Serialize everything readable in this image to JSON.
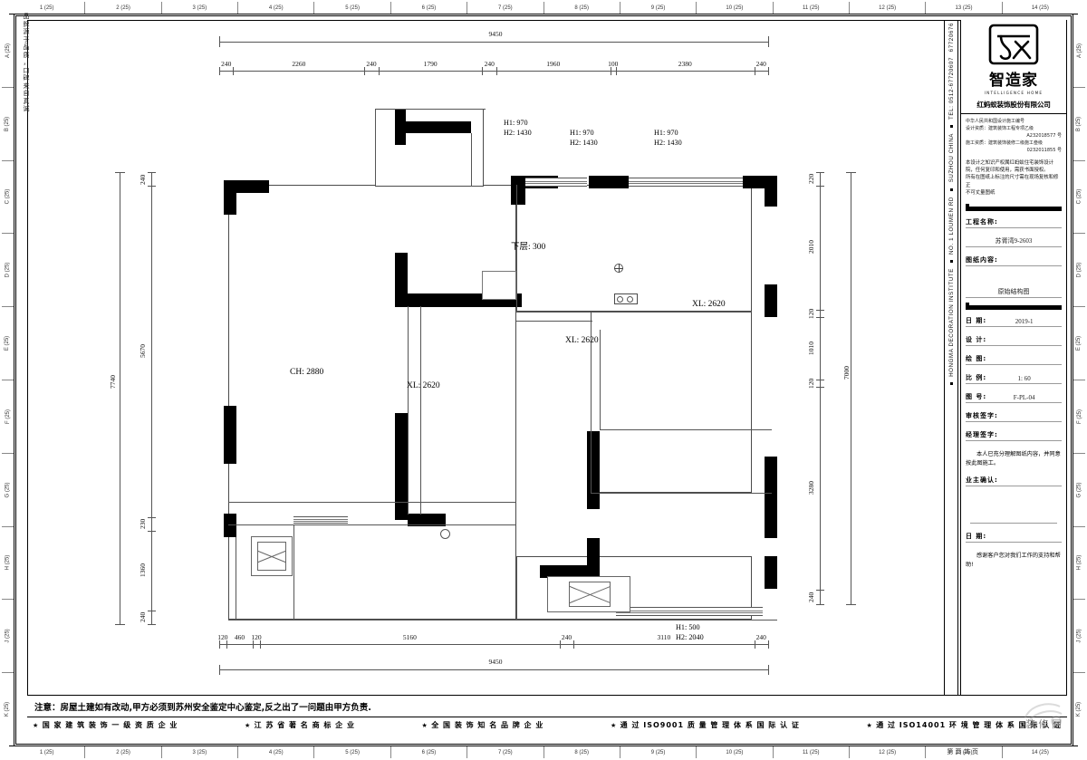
{
  "sheet": {
    "slogan_vertical": "品牌源于品质，口碑来自真诚",
    "sheet_number_label": "第 页 共 页"
  },
  "rulers": {
    "h_ticks": [
      "1 (25)",
      "2 (25)",
      "3 (25)",
      "4 (25)",
      "5 (25)",
      "6 (25)",
      "7 (25)",
      "8 (25)",
      "9 (25)",
      "10 (25)",
      "11 (25)",
      "12 (25)",
      "13 (25)",
      "14 (25)"
    ],
    "v_ticks": [
      "A\n(25)",
      "B\n(25)",
      "C\n(25)",
      "D\n(25)",
      "E\n(25)",
      "F\n(25)",
      "G\n(25)",
      "H\n(25)",
      "J\n(25)",
      "K\n(25)"
    ],
    "v_ticks_flat": [
      "A (25)",
      "B (25)",
      "C (25)",
      "D (25)",
      "E (25)",
      "F (25)",
      "G (25)",
      "H (25)",
      "J (25)",
      "K (25)"
    ]
  },
  "vertical_strip": {
    "line1": "HONGMA DECORATION INSTITUTE",
    "line2": "SUZHOU CHINA",
    "line3": "TEL: 0512-67720607",
    "line4": "67720676",
    "line5": "NO. 1 LOUMEN RD"
  },
  "title_block": {
    "brand_cn": "智造家",
    "brand_en": "INTELLIGENCE HOME",
    "company": "红蚂蚁装饰股份有限公司",
    "cert": {
      "l1": "中华人民共和国设计施工编号",
      "l2": "设计资质：建筑装饰工程专项乙级",
      "l3": "A232018577 号",
      "l4": "施工资质：建筑装饰装修二级施工叁级",
      "l5": "0232011855 号"
    },
    "legal": "本设计之知识产权属红蚂蚁住宅装饰设计院，任何复印和使用，需获书面授权。\n所有在图纸上标注的尺寸需在现场复核和修正\n不可丈量图纸",
    "fields": [
      {
        "key": "工程名称:",
        "value": ""
      },
      {
        "key": "",
        "value": "苏胥湾9-2603"
      },
      {
        "key": "图纸内容:",
        "value": ""
      },
      {
        "key": "",
        "value": "原始结构图"
      }
    ],
    "project_name_label": "工程名称:",
    "project_name_value": "苏胥湾9-2603",
    "drawing_content_label": "图纸内容:",
    "drawing_content_value": "原始结构图",
    "meta": [
      {
        "key": "日  期:",
        "value": "2019-1"
      },
      {
        "key": "设  计:",
        "value": ""
      },
      {
        "key": "绘  图:",
        "value": ""
      },
      {
        "key": "比  例:",
        "value": "1: 60"
      },
      {
        "key": "图  号:",
        "value": "F-PL-04"
      },
      {
        "key": "审核签字:",
        "value": ""
      },
      {
        "key": "经理签字:",
        "value": ""
      }
    ],
    "owner_confirm_text": "本人已充分理解图纸内容，并同意按此图施工。",
    "owner_confirm_label": "业主确认:",
    "date_label": "日    期:",
    "thanks_text": "感谢客户您对我们工作的支持和帮助!"
  },
  "notes": {
    "warning": "注意：房屋土建如有改动,甲方必须到苏州安全鉴定中心鉴定,反之出了一问题由甲方负责.",
    "certs": [
      "国 家 建 筑 装 饰 一 级 资 质 企 业",
      "江 苏 省 著 名 商 标 企 业",
      "全 国 装 饰 知 名 品 牌 企 业",
      "通 过 ISO9001 质 量 管 理 体 系 国 际 认 证",
      "通 过 ISO14001 环 境 管 理 体 系 国 际 认 证"
    ],
    "watermark": "装 修 网"
  },
  "chart_data": {
    "type": "table",
    "title": "原始结构图 — 苏胥湾9-2603",
    "scale": "1: 60",
    "dimensions_top_total": "9450",
    "dimensions_top_chain": [
      "240",
      "2260",
      "240",
      "1790",
      "240",
      "1960",
      "100",
      "2380",
      "240"
    ],
    "dimensions_bottom_total": "9450",
    "dimensions_bottom_chain": [
      "120",
      "460",
      "120",
      "5160",
      "240",
      "3110",
      "240"
    ],
    "dimensions_left_total": "7740",
    "dimensions_left_chain": [
      "240",
      "5670",
      "230",
      "1360",
      "240"
    ],
    "dimensions_right_total": "7000",
    "dimensions_right_chain": [
      "220",
      "2010",
      "120",
      "1010",
      "120",
      "3280",
      "240"
    ]
  },
  "plan": {
    "labels": {
      "ceiling_height": "CH: 2880",
      "beam_1": "XL: 2620",
      "beam_2": "XL: 2620",
      "beam_3": "XL: 2620",
      "lower_slab": "下层: 300"
    },
    "window_notes": [
      {
        "h1": "H1: 970",
        "h2": "H2: 1430"
      },
      {
        "h1": "H1: 970",
        "h2": "H2: 1430"
      },
      {
        "h1": "H1: 970",
        "h2": "H2: 1430"
      },
      {
        "h1": "H1: 500",
        "h2": "H2: 2040"
      }
    ]
  },
  "dim_top": {
    "total": "9450",
    "chain": [
      "240",
      "2260",
      "240",
      "1790",
      "240",
      "1960",
      "100",
      "2380",
      "240"
    ]
  },
  "dim_bottom": {
    "total": "9450",
    "chain": [
      "120",
      "460",
      "120",
      "5160",
      "240",
      "3110",
      "240"
    ]
  },
  "dim_left": {
    "total": "7740",
    "chain": [
      "240",
      "5670",
      "230",
      "1360",
      "240"
    ]
  },
  "dim_right": {
    "total": "7000",
    "chain": [
      "220",
      "2010",
      "120",
      "1010",
      "120",
      "3280",
      "240"
    ]
  }
}
